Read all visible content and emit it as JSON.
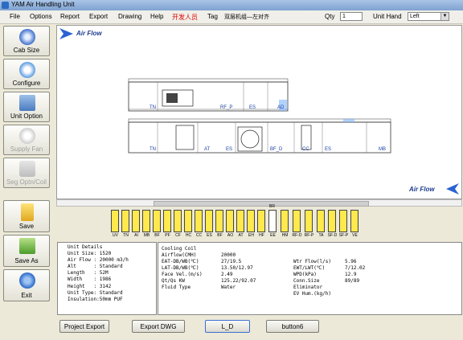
{
  "window": {
    "title": "YAM  Air Handling Unit"
  },
  "menu": [
    "File",
    "Options",
    "Report",
    "Export",
    "Drawing",
    "Help",
    "开发人员",
    "Tag",
    "双层机组—左对齐"
  ],
  "qty": {
    "label": "Qty",
    "value": "1"
  },
  "unit_hand": {
    "label": "Unit Hand",
    "value": "Left"
  },
  "toolbar": [
    {
      "label": "Cab Size",
      "icon": "cabinet-size-icon",
      "enabled": true
    },
    {
      "label": "Configure",
      "icon": "configure-icon",
      "enabled": true
    },
    {
      "label": "Unit Option",
      "icon": "unit-option-icon",
      "enabled": true
    },
    {
      "label": "Supply Fan",
      "icon": "supply-fan-icon",
      "enabled": false
    },
    {
      "label": "Seg Optn/Coil",
      "icon": "segment-option-icon",
      "enabled": false
    },
    {
      "label": "Save",
      "icon": "save-icon",
      "enabled": true
    },
    {
      "label": "Save As",
      "icon": "save-as-icon",
      "enabled": true
    },
    {
      "label": "Exit",
      "icon": "exit-icon",
      "enabled": true
    }
  ],
  "drawing": {
    "airflow_top": "Air Flow",
    "airflow_bottom": "Air Flow",
    "upper_labels": [
      "TN",
      "RF_P",
      "ES",
      "AD"
    ],
    "lower_labels": [
      "TN",
      "AT",
      "ES",
      "BF_D",
      "CC",
      "ES",
      "MB"
    ]
  },
  "palette": [
    "UV",
    "TN",
    "AI",
    "MB",
    "BF",
    "PF",
    "CF",
    "HC",
    "CC",
    "ES",
    "BF",
    "AO",
    "AT",
    "EH",
    "HF",
    "EE",
    "HM",
    "RF-D",
    "RF-P",
    "TA",
    "SF-D",
    "SF-P",
    "VE"
  ],
  "palette_extra": "BR",
  "unit_details": [
    "Unit Details",
    "Unit Size: 1520",
    "Air Flow : 20000 m3/h",
    "Alt      : Standard",
    "Length   : 52M",
    "Width    : 1986",
    "Height   : 3142",
    "Unit Type: Standard",
    "Insulation:50mm PUF"
  ],
  "coil": {
    "title": "Cooling Coil",
    "rows_left": [
      [
        "Airflow(CMH)",
        "20000"
      ],
      [
        "EAT-DB/WB(℃)",
        "27/19.5"
      ],
      [
        "LAT-DB/WB(℃)",
        "13.50/12.97"
      ],
      [
        "Face Vel.(m/s)",
        "2.49"
      ],
      [
        "Qt/Qs KW",
        "125.22/92.07"
      ],
      [
        "Fluid Type",
        "Water"
      ]
    ],
    "rows_right": [
      [
        "Wtr Flow(l/s)",
        "5.96"
      ],
      [
        "EWT/LWT(℃)",
        "7/12.02"
      ],
      [
        "WPD(kPa)",
        "12.9"
      ],
      [
        "Conn.Size",
        "89/89"
      ],
      [
        "Eliminator",
        ""
      ],
      [
        "EV Hum.(kg/h)",
        ""
      ]
    ]
  },
  "buttons": [
    "Project Export",
    "Export DWG",
    "L_D",
    "button6"
  ]
}
